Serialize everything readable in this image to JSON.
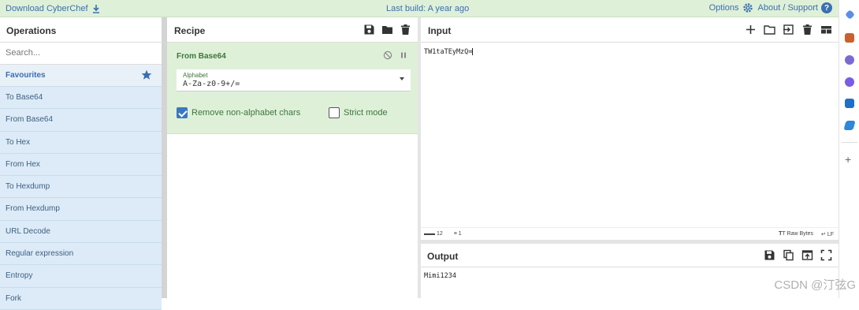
{
  "banner": {
    "download_label": "Download CyberChef",
    "last_build": "Last build: A year ago",
    "options_label": "Options",
    "about_label": "About / Support"
  },
  "operations": {
    "title": "Operations",
    "search_placeholder": "Search...",
    "favourites_label": "Favourites",
    "items": [
      "To Base64",
      "From Base64",
      "To Hex",
      "From Hex",
      "To Hexdump",
      "From Hexdump",
      "URL Decode",
      "Regular expression",
      "Entropy",
      "Fork"
    ]
  },
  "recipe": {
    "title": "Recipe",
    "operation": {
      "name": "From Base64",
      "alphabet_label": "Alphabet",
      "alphabet_value": "A-Za-z0-9+/=",
      "remove_label": "Remove non-alphabet chars",
      "remove_checked": true,
      "strict_label": "Strict mode",
      "strict_checked": false
    }
  },
  "input": {
    "title": "Input",
    "value": "TW1taTEyMzQ=",
    "length": "12",
    "lines": "1",
    "raw_bytes_label": "Raw Bytes",
    "eol_label": "LF"
  },
  "output": {
    "title": "Output",
    "value": "Mimi1234"
  },
  "watermark": "CSDN @汀弦G",
  "colors": {
    "accent": "#3a6fb0",
    "banner_bg": "#dff0d8",
    "operation_bg": "#dcebf7",
    "recipe_card_bg": "#dff0d8"
  }
}
